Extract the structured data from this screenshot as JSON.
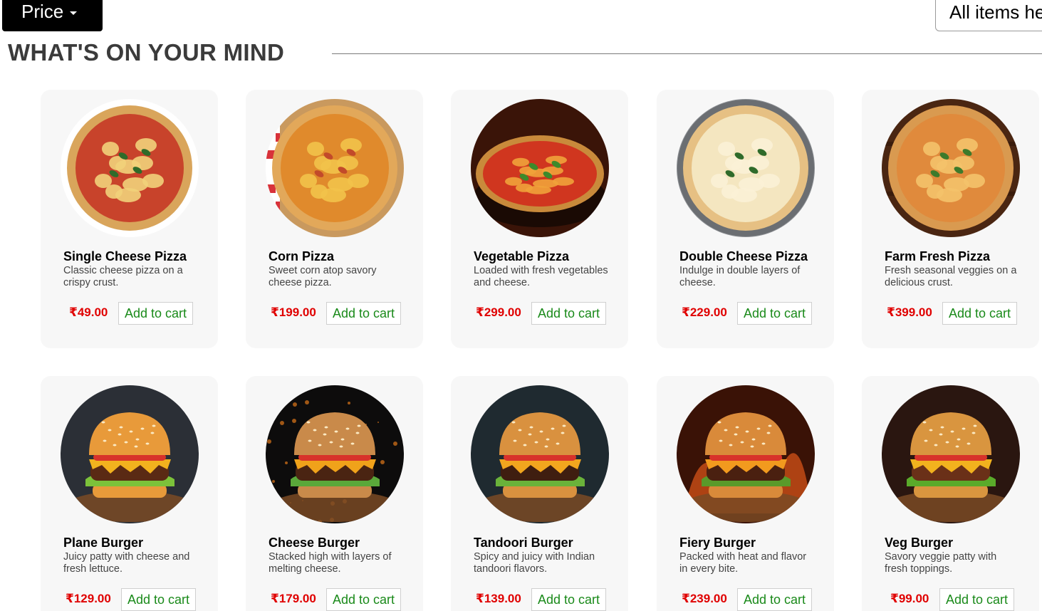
{
  "header": {
    "price_button_label": "Price",
    "all_items_label": "All items he"
  },
  "section": {
    "title": "WHAT'S ON YOUR MIND"
  },
  "menu_items": [
    {
      "name": "Single Cheese Pizza",
      "description": "Classic cheese pizza on a crispy crust.",
      "price": "₹49.00",
      "button": "Add to cart",
      "kind": "pizza",
      "colors": {
        "crust": "#d9a55b",
        "sauce": "#c8432b",
        "top": "#f1d27a",
        "leaf": "#2f6b2a"
      }
    },
    {
      "name": "Corn Pizza",
      "description": "Sweet corn atop savory cheese pizza.",
      "price": "₹199.00",
      "button": "Add to cart",
      "kind": "pizza",
      "colors": {
        "crust": "#e2a85a",
        "sauce": "#e08a2c",
        "top": "#f2c24a",
        "leaf": "#c24a2a"
      }
    },
    {
      "name": "Vegetable Pizza",
      "description": "Loaded with fresh vegetables and cheese.",
      "price": "₹299.00",
      "button": "Add to cart",
      "kind": "pizza",
      "colors": {
        "crust": "#c98a3b",
        "sauce": "#d0361f",
        "top": "#f0a23a",
        "leaf": "#3d8a2b",
        "bg": "#3a1408"
      }
    },
    {
      "name": "Double Cheese Pizza",
      "description": "Indulge in double layers of cheese.",
      "price": "₹229.00",
      "button": "Add to cart",
      "kind": "pizza",
      "colors": {
        "crust": "#e6c083",
        "sauce": "#f4e6c0",
        "top": "#fbf1d6",
        "leaf": "#2f6b2a",
        "bg": "#8c8f93"
      }
    },
    {
      "name": "Farm Fresh Pizza",
      "description": "Fresh seasonal veggies on a delicious crust.",
      "price": "₹399.00",
      "button": "Add to cart",
      "kind": "pizza",
      "colors": {
        "crust": "#d99a50",
        "sauce": "#e08a3c",
        "top": "#f4c26a",
        "leaf": "#3d7a2b",
        "bg": "#4a2612"
      }
    },
    {
      "name": "Plane Burger",
      "description": "Juicy patty with cheese and fresh lettuce.",
      "price": "₹129.00",
      "button": "Add to cart",
      "kind": "burger",
      "colors": {
        "bun": "#e89a3a",
        "patty": "#5a2a14",
        "cheese": "#f2b21e",
        "lettuce": "#7cc23a",
        "bg": "#2b2f36"
      }
    },
    {
      "name": "Cheese Burger",
      "description": "Stacked high with layers of melting cheese.",
      "price": "₹179.00",
      "button": "Add to cart",
      "kind": "burger",
      "colors": {
        "bun": "#c98a4a",
        "patty": "#4a2412",
        "cheese": "#f0a21a",
        "lettuce": "#5aa83a",
        "bg": "#0d0c0c"
      }
    },
    {
      "name": "Tandoori Burger",
      "description": "Spicy and juicy with Indian tandoori flavors.",
      "price": "₹139.00",
      "button": "Add to cart",
      "kind": "burger",
      "colors": {
        "bun": "#d9913f",
        "patty": "#3f1e10",
        "cheese": "#f2a61e",
        "lettuce": "#6ab23a",
        "bg": "#1f2a30"
      }
    },
    {
      "name": "Fiery Burger",
      "description": "Packed with heat and flavor in every bite.",
      "price": "₹239.00",
      "button": "Add to cart",
      "kind": "burger",
      "colors": {
        "bun": "#d98a3a",
        "patty": "#4a2010",
        "cheese": "#f29a1e",
        "lettuce": "#5a9a2a",
        "bg": "#3a1206"
      }
    },
    {
      "name": "Veg Burger",
      "description": "Savory veggie patty with fresh toppings.",
      "price": "₹99.00",
      "button": "Add to cart",
      "kind": "burger",
      "colors": {
        "bun": "#d9953f",
        "patty": "#6a3018",
        "cheese": "#f2b21e",
        "lettuce": "#5aaa2a",
        "bg": "#2a1610"
      }
    }
  ]
}
